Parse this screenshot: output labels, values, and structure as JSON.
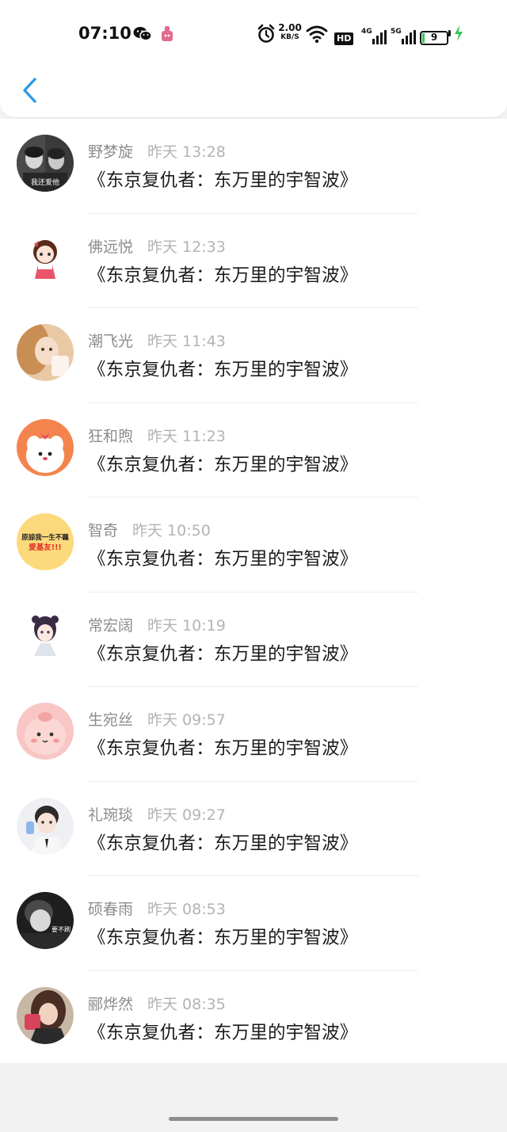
{
  "status_bar": {
    "time": "07:10",
    "network_speed": "2.00",
    "network_speed_unit": "KB/S",
    "hd_label": "HD",
    "sig1_label": "4G",
    "sig2_label": "5G",
    "battery_level": "9",
    "icons": [
      "wechat-icon",
      "app-notification-icon",
      "alarm-icon",
      "wifi-icon",
      "hd-icon",
      "signal-4g-icon",
      "signal-5g-icon",
      "battery-icon",
      "charging-icon"
    ]
  },
  "header": {
    "back_icon": "chevron-left-icon",
    "accent_color": "#2f9be3"
  },
  "items": [
    {
      "name": "野梦旋",
      "time": "昨天 13:28",
      "title": "《东京复仇者：东万里的宇智波》"
    },
    {
      "name": "佛远悦",
      "time": "昨天 12:33",
      "title": "《东京复仇者：东万里的宇智波》"
    },
    {
      "name": "潮飞光",
      "time": "昨天 11:43",
      "title": "《东京复仇者：东万里的宇智波》"
    },
    {
      "name": "狂和煦",
      "time": "昨天 11:23",
      "title": "《东京复仇者：东万里的宇智波》"
    },
    {
      "name": "智奇",
      "time": "昨天 10:50",
      "title": "《东京复仇者：东万里的宇智波》"
    },
    {
      "name": "常宏阔",
      "time": "昨天 10:19",
      "title": "《东京复仇者：东万里的宇智波》"
    },
    {
      "name": "生宛丝",
      "time": "昨天 09:57",
      "title": "《东京复仇者：东万里的宇智波》"
    },
    {
      "name": "礼琬琰",
      "time": "昨天 09:27",
      "title": "《东京复仇者：东万里的宇智波》"
    },
    {
      "name": "硕春雨",
      "time": "昨天 08:53",
      "title": "《东京复仇者：东万里的宇智波》"
    },
    {
      "name": "郦烨然",
      "time": "昨天 08:35",
      "title": "《东京复仇者：东万里的宇智波》"
    }
  ],
  "avatar_texts": {
    "a0": "我还爱他",
    "a4_line1": "原諒我一生不羈",
    "a4_line2": "愛基友!!!",
    "a8": "要不刷"
  }
}
